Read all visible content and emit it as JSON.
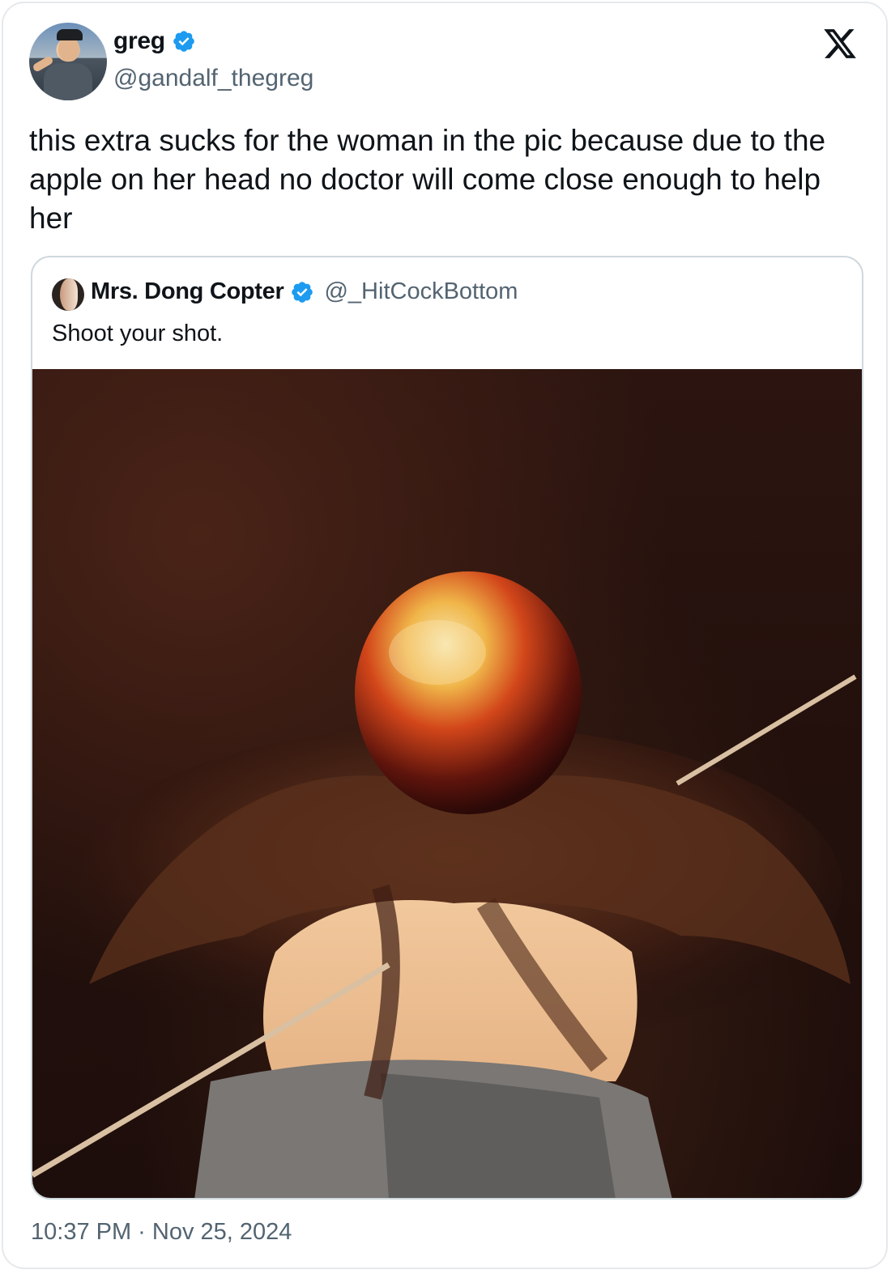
{
  "author": {
    "name": "greg",
    "handle": "@gandalf_thegreg",
    "verified": true
  },
  "platform_icon": "x-logo-icon",
  "tweet_text": "this extra sucks for the woman in the pic because due to the apple on her head no doctor will come close enough to help her",
  "quoted": {
    "name": "Mrs. Dong Copter",
    "handle": "@_HitCockBottom",
    "verified": true,
    "text": "Shoot your shot.",
    "media": "photo of a woman seen from behind with an apple on her head and an arrow passing by"
  },
  "timestamp": "10:37 PM · Nov 25, 2024",
  "colors": {
    "verified_blue": "#1d9bf0",
    "secondary_text": "#536471",
    "primary_text": "#0f1419",
    "border": "#cfd9de"
  }
}
